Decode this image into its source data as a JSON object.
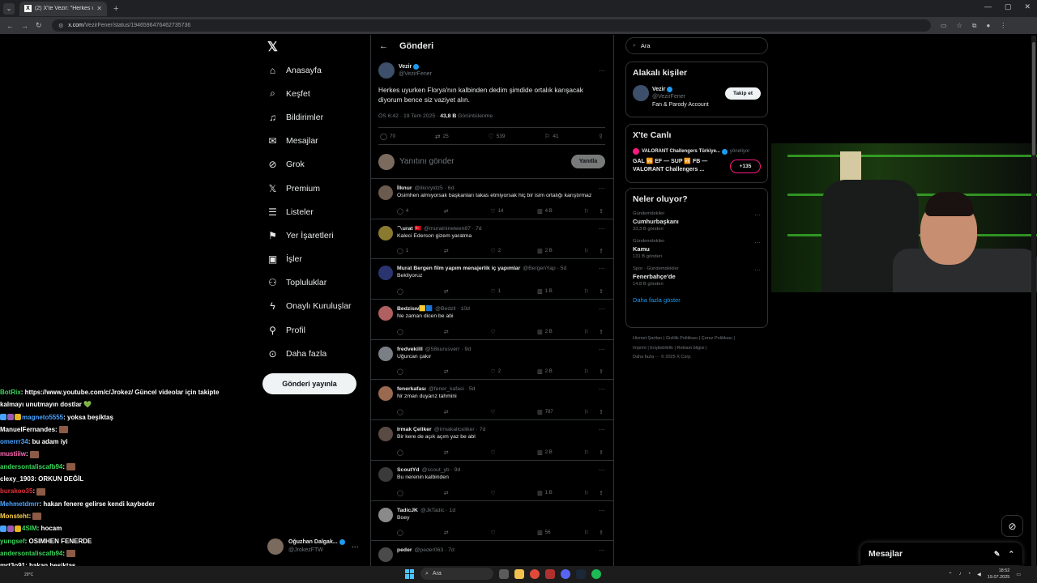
{
  "browser": {
    "tab_title": "(2) X'te Vezir: \"Herkes uyurken F...",
    "url_host": "x.com",
    "url_path": "/VezirFener/status/1946596476462735736"
  },
  "nav": {
    "items": [
      {
        "label": "Anasayfa",
        "icon": "home-icon",
        "glyph": "⌂"
      },
      {
        "label": "Keşfet",
        "icon": "search-icon",
        "glyph": "⌕"
      },
      {
        "label": "Bildirimler",
        "icon": "bell-icon",
        "glyph": "♫"
      },
      {
        "label": "Mesajlar",
        "icon": "mail-icon",
        "glyph": "✉"
      },
      {
        "label": "Grok",
        "icon": "grok-icon",
        "glyph": "⊘"
      },
      {
        "label": "Premium",
        "icon": "x-premium-icon",
        "glyph": "𝕏"
      },
      {
        "label": "Listeler",
        "icon": "list-icon",
        "glyph": "☰"
      },
      {
        "label": "Yer İşaretleri",
        "icon": "bookmark-icon",
        "glyph": "⚑"
      },
      {
        "label": "İşler",
        "icon": "briefcase-icon",
        "glyph": "▣"
      },
      {
        "label": "Topluluklar",
        "icon": "communities-icon",
        "glyph": "⚇"
      },
      {
        "label": "Onaylı Kuruluşlar",
        "icon": "lightning-icon",
        "glyph": "ϟ"
      },
      {
        "label": "Profil",
        "icon": "profile-icon",
        "glyph": "⚲"
      },
      {
        "label": "Daha fazla",
        "icon": "more-circle-icon",
        "glyph": "⊙"
      }
    ],
    "post_button": "Gönderi yayınla"
  },
  "account": {
    "name": "Oğuzhan Dalgak...",
    "handle": "@JrokezFTW"
  },
  "center": {
    "header": "Gönderi",
    "post": {
      "author": "Vezir",
      "handle": "@VezirFener",
      "text": "Herkes uyurken Florya'nın kalbinden dedim şimdide ortalık karışacak diyorum bence siz vaziyet alın.",
      "time": "ÖS 6:42 · 19 Tem 2025 · ",
      "views": "43,8 B",
      "views_label": " Görüntülenme",
      "replies": "70",
      "reposts": "25",
      "likes": "539",
      "bookmarks": "41"
    },
    "reply_placeholder": "Yanıtını gönder",
    "reply_button": "Yanıtla",
    "replies": [
      {
        "name": "İlknur",
        "handle": "@ilknryldz5 · 6d",
        "text": "Osimhen almıyorsak başkanları takas etmiyorsak hiç bir isim ortalığı karıştırmaz",
        "reply": "4",
        "repost": "",
        "like": "14",
        "views": "4 B",
        "color": "#6b5a4e"
      },
      {
        "name": "〽urat 🇹🇷",
        "handle": "@muratnineteen87 · 7d",
        "text": "Kaleci Ederson gizem yaratma",
        "reply": "1",
        "repost": "",
        "like": "2",
        "views": "2 B",
        "color": "#8a7a30"
      },
      {
        "name": "Murat Bergen film yapım menajerlik iç yapımlar",
        "handle": "@BergenYap · 5d",
        "text": "Bekliyoruz",
        "reply": "",
        "repost": "",
        "like": "1",
        "views": "1 B",
        "color": "#2a3570"
      },
      {
        "name": "Bedzisw🟨🟦",
        "handle": "@Bedzll · 10d",
        "text": "Ne zaman dicen be abi",
        "reply": "",
        "repost": "",
        "like": "",
        "views": "2 B",
        "color": "#b06060"
      },
      {
        "name": "fredvekilll",
        "handle": "@58kurusverr · 9d",
        "text": "Uğurcan çakır",
        "reply": "",
        "repost": "",
        "like": "2",
        "views": "2 B",
        "color": "#7a7f86"
      },
      {
        "name": "fenerkafası",
        "handle": "@fener_kafasi · 5d",
        "text": "Nr zman duyarız tahmini",
        "reply": "",
        "repost": "",
        "like": "",
        "views": "787",
        "color": "#9a6a50"
      },
      {
        "name": "Irmak Çeliker",
        "handle": "@irmakaliceliker · 7d",
        "text": "Bir kere de açık açım yaz be abl",
        "reply": "",
        "repost": "",
        "like": "",
        "views": "2 B",
        "color": "#5a4a44"
      },
      {
        "name": "ScoutYd",
        "handle": "@scout_yb · 9d",
        "text": "Bu nerenin kalbinden",
        "reply": "",
        "repost": "",
        "like": "",
        "views": "1 B",
        "color": "#3a3a3a"
      },
      {
        "name": "TadicJK",
        "handle": "@JkTadic · 1d",
        "text": "Boey",
        "reply": "",
        "repost": "",
        "like": "",
        "views": "56",
        "color": "#8a8a8a"
      },
      {
        "name": "peder",
        "handle": "@peder063 · 7d",
        "text": "",
        "reply": "",
        "repost": "",
        "like": "",
        "views": "",
        "color": "#4a4a4a"
      }
    ]
  },
  "right": {
    "search_placeholder": "Ara",
    "related": {
      "title": "Alakalı kişiler",
      "name": "Vezir",
      "handle": "@VezirFener",
      "bio": "Fan & Parody Account",
      "follow": "Takip et"
    },
    "live": {
      "title": "X'te Canlı",
      "source": "VALORANT Challengers Türkiye...",
      "host": "yönetiyor",
      "line1": "GAL 🆚 EF — SUP 🆚 FB —",
      "line2": "VALORANT Challengers ...",
      "count": "+135"
    },
    "trends": {
      "title": "Neler oluyor?",
      "items": [
        {
          "cat": "Gündemdekiler",
          "name": "Cumhurbaşkanı",
          "count": "33,3 B gönderi"
        },
        {
          "cat": "Gündemdekiler",
          "name": "Kamu",
          "count": "131 B gönderi"
        },
        {
          "cat": "Spor · Gündemdekiler",
          "name": "Fenerbahçe'de",
          "count": "14,8 B gönderi"
        }
      ],
      "more": "Daha fazla göster"
    },
    "footer": [
      "Hizmet Şartları  |  Gizlilik Politikası  |  Çerez Politikası  |",
      "Imprint  |  Erişilebilirlik  |  Reklam bilgisi  |",
      "Daha fazla ···  © 2025 X Corp."
    ]
  },
  "drawer": {
    "label": "Mesajlar"
  },
  "chat": [
    {
      "user": "BotRix",
      "color": "#3ad65a",
      "text": ": https://www.youtube.com/c/Jrokez/ Güncel videolar için takipte",
      "emote": false
    },
    {
      "user": "",
      "color": "#fff",
      "text": "kalmayı unutmayın dostlar 💚",
      "emote": false
    },
    {
      "user": "magneto5555",
      "color": "#4aa3ff",
      "text": ": yoksa beşiktaş",
      "emote": false
    },
    {
      "user": "ManuelFernandes",
      "color": "#ffffff",
      "text": ":",
      "emote": true
    },
    {
      "user": "omerrr34",
      "color": "#4aa3ff",
      "text": ": bu adam iyi",
      "emote": false
    },
    {
      "user": "mustiiiw",
      "color": "#ff69b4",
      "text": ":",
      "emote": true
    },
    {
      "user": "andersontaliscafb94",
      "color": "#3ad65a",
      "text": ":",
      "emote": true
    },
    {
      "user": "clexy_1903",
      "color": "#ffffff",
      "text": ": ORKUN DEĞİL",
      "emote": false
    },
    {
      "user": "burakoo35",
      "color": "#e0303a",
      "text": ":",
      "emote": true
    },
    {
      "user": "Mehmetdmrr",
      "color": "#4aa3ff",
      "text": ": hakan fenere gelirse kendi kaybeder",
      "emote": false
    },
    {
      "user": "Monsteht",
      "color": "#ffd24a",
      "text": ":",
      "emote": true
    },
    {
      "user": "4SIM",
      "color": "#3ad65a",
      "text": ": hocam",
      "emote": false
    },
    {
      "user": "yungsef",
      "color": "#3ad65a",
      "text": ": OSIMHEN FENERDE",
      "emote": false
    },
    {
      "user": "andersontaliscafb94",
      "color": "#3ad65a",
      "text": ":",
      "emote": true
    },
    {
      "user": "mrt3o91",
      "color": "#ffffff",
      "text": ": hakan beşiktaş",
      "emote": false
    }
  ],
  "taskbar": {
    "weather": "29°C",
    "search": "Ara",
    "time": "18:52",
    "date": "19.07.2025"
  }
}
